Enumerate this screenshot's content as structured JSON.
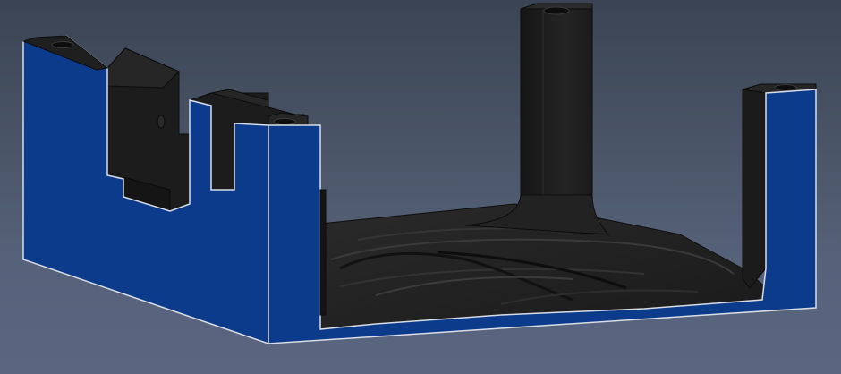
{
  "viewport": {
    "background_top": "#3a4454",
    "background_bottom": "#5a6680"
  },
  "model": {
    "section_face_color": "#0d3b8c",
    "body_color": "#1c1c1c",
    "edge_color": "#d9dde5"
  }
}
